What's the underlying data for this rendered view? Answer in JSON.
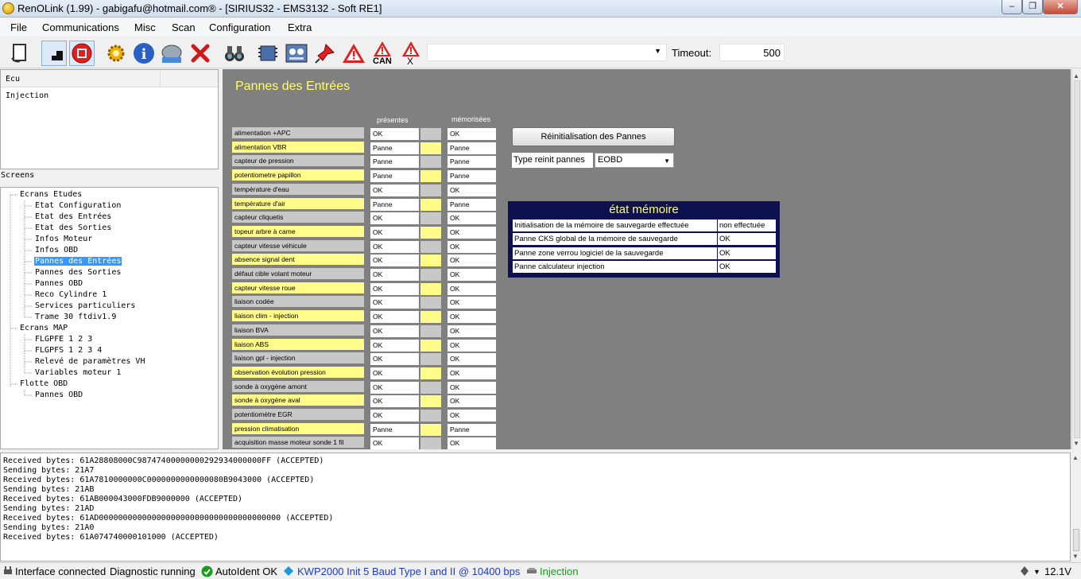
{
  "window": {
    "title": "RenOLink (1.99) - gabigafu@hotmail.com® -  [SIRIUS32 - EMS3132 - Soft RE1]",
    "min": "–",
    "max": "❐",
    "close": "✕"
  },
  "menu": [
    "File",
    "Communications",
    "Misc",
    "Scan",
    "Configuration",
    "Extra"
  ],
  "toolbar": {
    "can_label": "CAN",
    "x_label": "X",
    "timeout_label": "Timeout:",
    "timeout_value": "500",
    "combo_value": ""
  },
  "ecu": {
    "header": "Ecu",
    "item": "Injection"
  },
  "screens_label": "Screens",
  "tree": {
    "ecrans_etudes": "Ecrans Etudes",
    "etudes_items": [
      "Etat Configuration",
      "Etat des Entrées",
      "Etat des Sorties",
      "Infos Moteur",
      "Infos OBD",
      "Pannes des Entrées",
      "Pannes des Sorties",
      "Pannes OBD",
      "Reco Cylindre 1",
      "Services particuliers",
      "Trame 30 ftdiv1.9"
    ],
    "ecrans_map": "Ecrans MAP",
    "map_items": [
      "FLGPFE 1 2 3",
      "FLGPFS 1 2 3 4",
      "Relevé de paramètres VH",
      "Variables moteur 1"
    ],
    "flotte": "Flotte OBD",
    "flotte_items": [
      "Pannes OBD"
    ]
  },
  "main": {
    "title": "Pannes des Entrées",
    "col_present": "présentes",
    "col_memo": "mémorisées",
    "rows": [
      {
        "label": "alimentation +APC",
        "present": "OK",
        "memo": "OK",
        "yellow": false
      },
      {
        "label": "alimentation VBR",
        "present": "Panne",
        "memo": "Panne",
        "yellow": true
      },
      {
        "label": "capteur de pression",
        "present": "Panne",
        "memo": "Panne",
        "yellow": false
      },
      {
        "label": "potentiometre papillon",
        "present": "Panne",
        "memo": "Panne",
        "yellow": true
      },
      {
        "label": "température d'eau",
        "present": "OK",
        "memo": "OK",
        "yellow": false
      },
      {
        "label": "température d'air",
        "present": "Panne",
        "memo": "Panne",
        "yellow": true
      },
      {
        "label": "capteur cliquetis",
        "present": "OK",
        "memo": "OK",
        "yellow": false
      },
      {
        "label": "topeur arbre à came",
        "present": "OK",
        "memo": "OK",
        "yellow": true
      },
      {
        "label": "capteur vitesse véhicule",
        "present": "OK",
        "memo": "OK",
        "yellow": false
      },
      {
        "label": "absence signal dent",
        "present": "OK",
        "memo": "OK",
        "yellow": true
      },
      {
        "label": "défaut cible volant moteur",
        "present": "OK",
        "memo": "OK",
        "yellow": false
      },
      {
        "label": "capteur vitesse roue",
        "present": "OK",
        "memo": "OK",
        "yellow": true
      },
      {
        "label": "liaison codée",
        "present": "OK",
        "memo": "OK",
        "yellow": false
      },
      {
        "label": "liaison clim - injection",
        "present": "OK",
        "memo": "OK",
        "yellow": true
      },
      {
        "label": "liaison BVA",
        "present": "OK",
        "memo": "OK",
        "yellow": false
      },
      {
        "label": "liaison ABS",
        "present": "OK",
        "memo": "OK",
        "yellow": true
      },
      {
        "label": "liaison gpl - injection",
        "present": "OK",
        "memo": "OK",
        "yellow": false
      },
      {
        "label": "observation évolution pression",
        "present": "OK",
        "memo": "OK",
        "yellow": true
      },
      {
        "label": "sonde à oxygène amont",
        "present": "OK",
        "memo": "OK",
        "yellow": false
      },
      {
        "label": "sonde à oxygène aval",
        "present": "OK",
        "memo": "OK",
        "yellow": true
      },
      {
        "label": "potentiomètre EGR",
        "present": "OK",
        "memo": "OK",
        "yellow": false
      },
      {
        "label": "pression climatisation",
        "present": "Panne",
        "memo": "Panne",
        "yellow": true
      },
      {
        "label": "acquisition masse moteur sonde 1 fil",
        "present": "OK",
        "memo": "OK",
        "yellow": false
      }
    ],
    "reinit_button": "Réinitialisation des Pannes",
    "type_reinit_label": "Type reinit pannes",
    "type_reinit_value": "EOBD",
    "etat": {
      "title": "état mémoire",
      "rows": [
        {
          "label": "Initialisation de la mémoire de sauvegarde effectuée",
          "value": "non effectuée"
        },
        {
          "label": "Panne CKS global de la mémoire de sauvegarde",
          "value": "OK"
        },
        {
          "label": "Panne zone verrou logiciel de la sauvegarde",
          "value": "OK"
        },
        {
          "label": "Panne calculateur injection",
          "value": "OK"
        }
      ]
    }
  },
  "log": [
    "Received bytes: 61A28808000C98747400000000292934000000FF (ACCEPTED)",
    "Sending bytes: 21A7",
    "Received bytes: 61A7810000000C0000000000000080B9043000 (ACCEPTED)",
    "Sending bytes: 21AB",
    "Received bytes: 61AB000043000FDB9000000 (ACCEPTED)",
    "Sending bytes: 21AD",
    "Received bytes: 61AD00000000000000000000000000000000000000 (ACCEPTED)",
    "Sending bytes: 21A0",
    "Received bytes: 61A074740000101000 (ACCEPTED)"
  ],
  "status": {
    "interface": "Interface connected",
    "diag": "Diagnostic running",
    "autoident": "AutoIdent OK",
    "kwp": "KWP2000 Init 5 Baud Type I and II @ 10400 bps",
    "injection": "Injection",
    "voltage": "12.1V"
  },
  "colors": {
    "title_yellow": "#ffff66",
    "etat_bg": "#0e1150",
    "row_yellow": "#fffc8a",
    "row_gray": "#c8c8c8",
    "main_bg": "#808080",
    "kwp_blue": "#1a3cc8",
    "injection_green": "#1a9a1a"
  }
}
